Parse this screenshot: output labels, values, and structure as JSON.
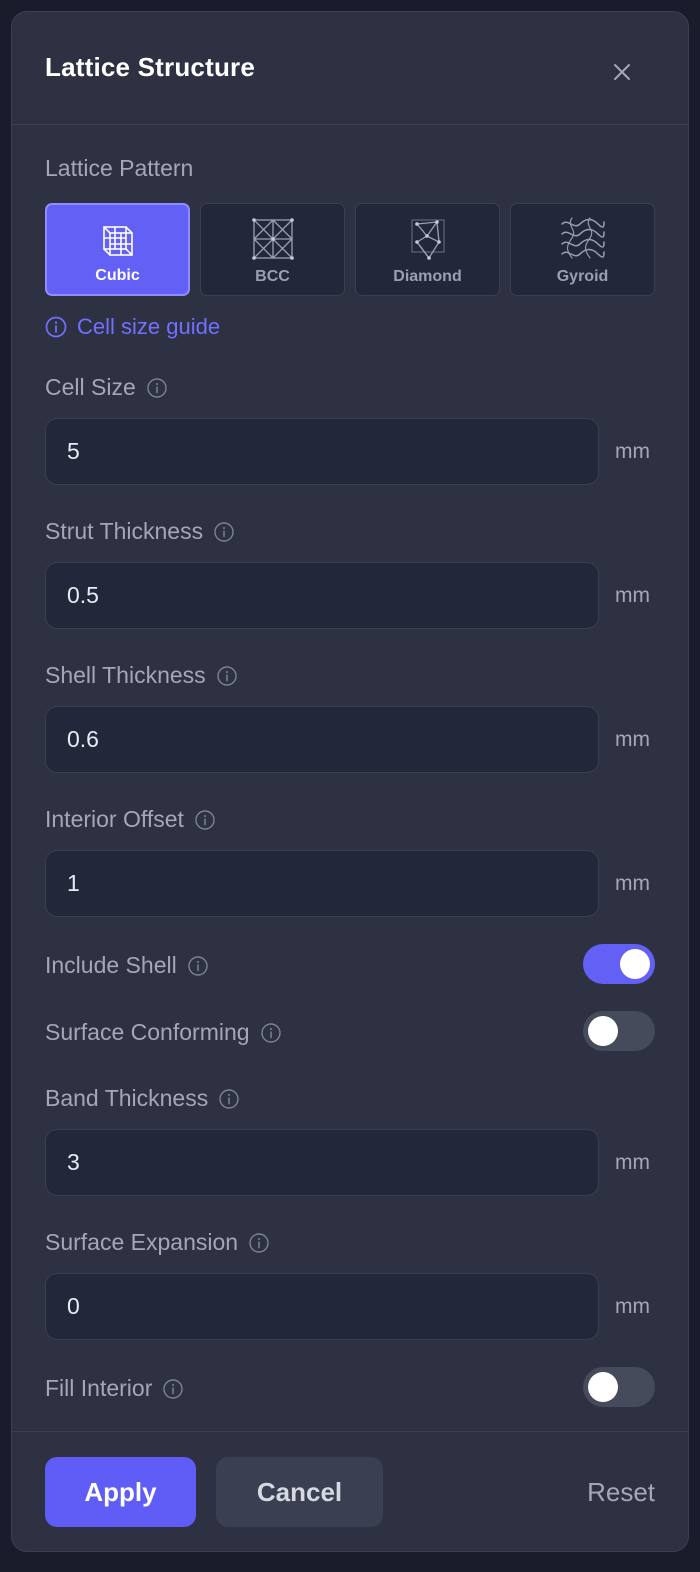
{
  "dialog": {
    "title": "Lattice Structure"
  },
  "pattern": {
    "label": "Lattice Pattern",
    "options": [
      {
        "label": "Cubic",
        "selected": true
      },
      {
        "label": "BCC",
        "selected": false
      },
      {
        "label": "Diamond",
        "selected": false
      },
      {
        "label": "Gyroid",
        "selected": false
      }
    ],
    "guide_link": "Cell size guide"
  },
  "fields": {
    "cell_size": {
      "label": "Cell Size",
      "value": "5",
      "unit": "mm"
    },
    "strut_thickness": {
      "label": "Strut Thickness",
      "value": "0.5",
      "unit": "mm"
    },
    "shell_thickness": {
      "label": "Shell Thickness",
      "value": "0.6",
      "unit": "mm"
    },
    "interior_offset": {
      "label": "Interior Offset",
      "value": "1",
      "unit": "mm"
    },
    "band_thickness": {
      "label": "Band Thickness",
      "value": "3",
      "unit": "mm"
    },
    "surface_expansion": {
      "label": "Surface Expansion",
      "value": "0",
      "unit": "mm"
    }
  },
  "toggles": {
    "include_shell": {
      "label": "Include Shell",
      "on": true
    },
    "surface_conforming": {
      "label": "Surface Conforming",
      "on": false
    },
    "fill_interior": {
      "label": "Fill Interior",
      "on": false
    }
  },
  "footer": {
    "apply_label": "Apply",
    "cancel_label": "Cancel",
    "reset_label": "Reset"
  },
  "colors": {
    "accent": "#6361f5",
    "background": "#1a1c2c",
    "panel": "#2d3142",
    "field": "#22283a"
  },
  "icons": {
    "close": "close-icon",
    "info": "info-icon",
    "cubic": "cubic-lattice-icon",
    "bcc": "bcc-lattice-icon",
    "diamond": "diamond-lattice-icon",
    "gyroid": "gyroid-lattice-icon"
  }
}
